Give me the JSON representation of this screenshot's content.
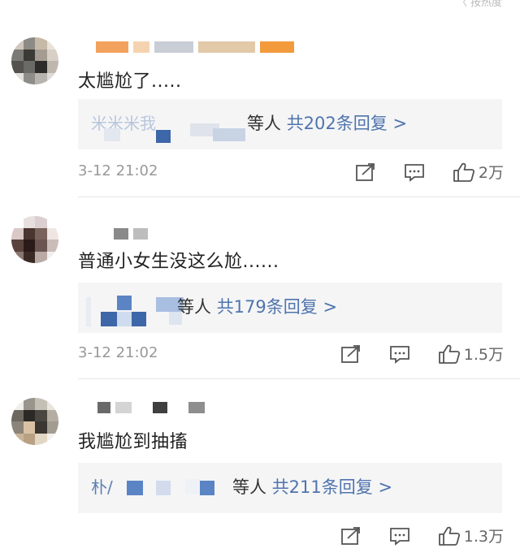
{
  "comments": [
    {
      "text": "太尴尬了.....",
      "reply_prefix": "米米米我",
      "reply_suffix": "等人 ",
      "reply_count": "共202条回复 >",
      "timestamp": "3-12 21:02",
      "likes": "2万"
    },
    {
      "text": "普通小女生没这么尬......",
      "reply_prefix": "",
      "reply_suffix": "等人 ",
      "reply_count": "共179条回复 >",
      "timestamp": "3-12 21:02",
      "likes": "1.5万"
    },
    {
      "text": "我尴尬到抽搐",
      "reply_prefix": "朴/",
      "reply_suffix": "等人 ",
      "reply_count": "共211条回复 >",
      "timestamp": "",
      "likes": "1.3万"
    }
  ],
  "colors": {
    "link_blue": "#4f74ad",
    "muted_gray": "#999999",
    "reply_bg": "#f5f5f6",
    "mosaic_blue": "#3d67a8"
  },
  "icons": [
    "share-icon",
    "comment-icon",
    "like-icon"
  ]
}
